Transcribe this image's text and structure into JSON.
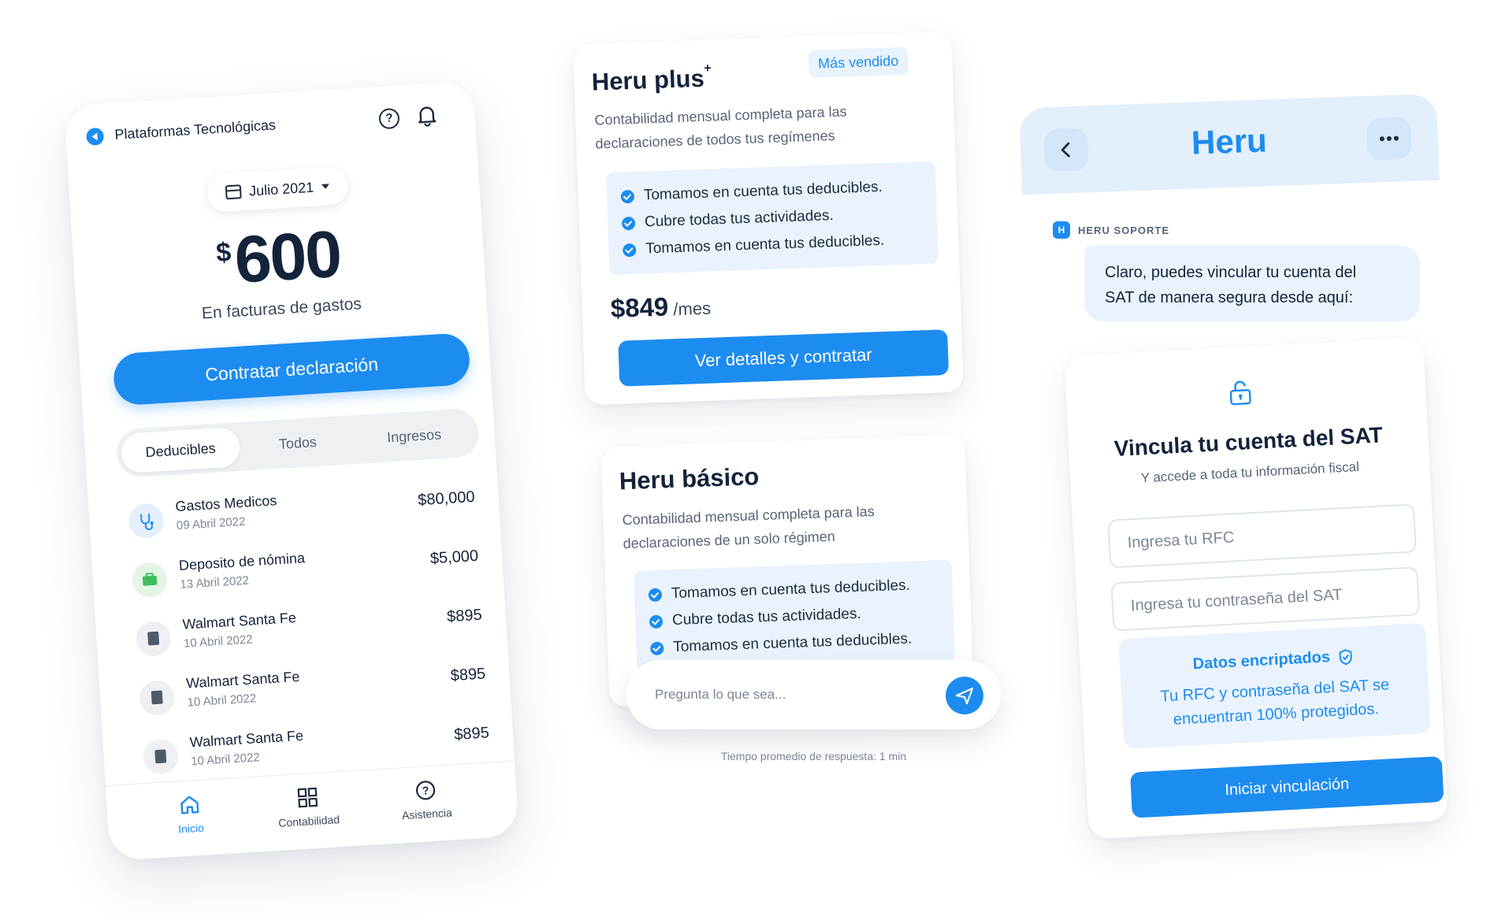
{
  "phone": {
    "title": "Plataformas Tecnológicas",
    "month": "Julio 2021",
    "currency": "$",
    "amount": "600",
    "amount_label": "En facturas de gastos",
    "cta": "Contratar declaración",
    "tabs": [
      "Deducibles",
      "Todos",
      "Ingresos"
    ],
    "transactions": [
      {
        "name": "Gastos Medicos",
        "date": "09 Abril 2022",
        "amount": "$80,000",
        "icon": "stethoscope-icon"
      },
      {
        "name": "Deposito de nómina",
        "date": "13 Abril 2022",
        "amount": "$5,000",
        "icon": "briefcase-icon"
      },
      {
        "name": "Walmart Santa Fe",
        "date": "10 Abril 2022",
        "amount": "$895",
        "icon": "document-icon"
      },
      {
        "name": "Walmart Santa Fe",
        "date": "10 Abril 2022",
        "amount": "$895",
        "icon": "document-icon"
      },
      {
        "name": "Walmart Santa Fe",
        "date": "10 Abril 2022",
        "amount": "$895",
        "icon": "document-icon"
      }
    ],
    "nav": [
      "Inicio",
      "Contabilidad",
      "Asistencia"
    ]
  },
  "plus": {
    "title": "Heru plus",
    "sup": "+",
    "badge": "Más vendido",
    "desc": [
      "Contabilidad mensual completa para las",
      "declaraciones de todos tus regímenes"
    ],
    "features": [
      "Tomamos en cuenta tus deducibles.",
      "Cubre todas tus actividades.",
      "Tomamos en cuenta tus deducibles."
    ],
    "price": "$849",
    "per": "/mes",
    "button": "Ver detalles y contratar"
  },
  "basico": {
    "title": "Heru básico",
    "desc": [
      "Contabilidad mensual completa para las",
      "declaraciones de un solo régimen"
    ],
    "features": [
      "Tomamos en cuenta tus deducibles.",
      "Cubre todas tus actividades.",
      "Tomamos en cuenta tus deducibles."
    ]
  },
  "chat": {
    "placeholder": "Pregunta lo que sea...",
    "footnote": "Tiempo promedio de respuesta: 1 min"
  },
  "support": {
    "header_title": "Heru",
    "sender_initial": "H",
    "sender": "HERU SOPORTE",
    "message": [
      "Claro, puedes vincular tu cuenta del",
      "SAT de manera segura desde aquí:"
    ],
    "card_title": "Vincula tu cuenta del SAT",
    "card_sub": "Y accede a toda tu información fiscal",
    "rfc_placeholder": "Ingresa tu RFC",
    "pwd_placeholder": "Ingresa tu contraseña del SAT",
    "enc_title": "Datos encriptados",
    "enc_desc": [
      "Tu RFC y contraseña del SAT se",
      "encuentran 100% protegidos."
    ],
    "button": "Iniciar vinculación"
  },
  "colors": {
    "accent": "#1d8cf0",
    "light": "#eaf3fd",
    "text": "#13233a"
  }
}
